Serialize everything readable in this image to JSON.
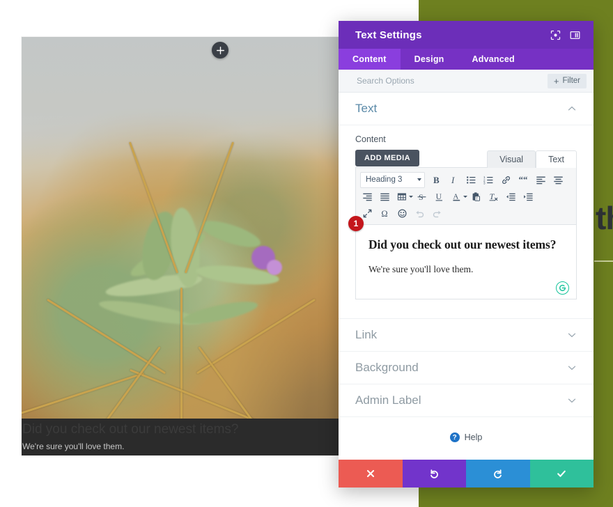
{
  "colors": {
    "olive": "#6e8020",
    "purple_header": "#6c2eb9",
    "purple_tabs": "#7631c4",
    "purple_tab_active": "#8a3ede",
    "badge_red": "#c4161c",
    "grammarly_green": "#15c39a",
    "footer_cancel": "#ec5b53",
    "footer_undo": "#7234cb",
    "footer_redo": "#2b8fd6",
    "footer_save": "#2fc09b",
    "add_media": "#4a5360"
  },
  "canvas": {
    "add_module_button": "+",
    "overlay": {
      "heading": "Did you check out our newest items?",
      "paragraph": "We're sure you'll love them."
    },
    "right_headline_fragment": "th"
  },
  "modal": {
    "title": "Text Settings",
    "header_icons": [
      {
        "name": "focus-target-icon"
      },
      {
        "name": "panel-layout-icon"
      }
    ],
    "tabs": [
      {
        "label": "Content",
        "active": true
      },
      {
        "label": "Design",
        "active": false
      },
      {
        "label": "Advanced",
        "active": false
      }
    ],
    "search": {
      "placeholder": "Search Options",
      "value": ""
    },
    "filter_button": {
      "plus": "+",
      "label": "Filter"
    },
    "sections": [
      {
        "label": "Text",
        "open": true
      },
      {
        "label": "Link",
        "open": false
      },
      {
        "label": "Background",
        "open": false
      },
      {
        "label": "Admin Label",
        "open": false
      }
    ],
    "content_field": {
      "label": "Content",
      "add_media_label": "ADD MEDIA",
      "editor_tabs": [
        {
          "label": "Visual",
          "active": false
        },
        {
          "label": "Text",
          "active": true
        }
      ],
      "format_select": {
        "value": "Heading 3"
      },
      "toolbar_row1": [
        {
          "name": "bold-icon"
        },
        {
          "name": "italic-icon"
        },
        {
          "name": "bulleted-list-icon"
        },
        {
          "name": "numbered-list-icon"
        },
        {
          "name": "link-icon"
        },
        {
          "name": "blockquote-icon"
        },
        {
          "name": "align-left-icon"
        },
        {
          "name": "align-center-icon"
        }
      ],
      "toolbar_row2": [
        {
          "name": "align-right-icon"
        },
        {
          "name": "align-justify-icon"
        },
        {
          "name": "table-icon"
        },
        {
          "name": "strikethrough-icon"
        },
        {
          "name": "underline-icon"
        },
        {
          "name": "text-color-icon"
        },
        {
          "name": "paste-as-text-icon"
        },
        {
          "name": "clear-formatting-icon"
        },
        {
          "name": "outdent-icon"
        },
        {
          "name": "indent-icon"
        }
      ],
      "toolbar_row3": [
        {
          "name": "fullscreen-icon"
        },
        {
          "name": "special-character-icon"
        },
        {
          "name": "emoji-icon"
        },
        {
          "name": "undo-icon"
        },
        {
          "name": "redo-icon"
        }
      ],
      "body": {
        "badge": "1",
        "heading": "Did you check out our newest items?",
        "paragraph": "We're sure you'll love them.",
        "grammar_icon": "grammarly-icon"
      }
    },
    "help": {
      "icon": "?",
      "label": "Help"
    },
    "footer_buttons": [
      {
        "name": "cancel-button",
        "icon": "close-icon"
      },
      {
        "name": "undo-button",
        "icon": "undo-icon"
      },
      {
        "name": "redo-button",
        "icon": "redo-icon"
      },
      {
        "name": "save-button",
        "icon": "check-icon"
      }
    ]
  }
}
